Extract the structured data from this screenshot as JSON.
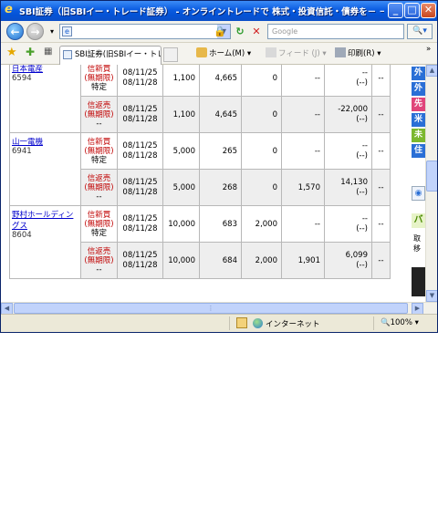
{
  "window": {
    "title": "SBI証券（旧SBIイー・トレード証券） - オンライントレードで 株式・投資信託・債券を－ － Win...",
    "minimize": "_",
    "maximize": "□",
    "close": "✕"
  },
  "address_bar": {
    "back": "←",
    "forward": "→",
    "url": "",
    "search_placeholder": "Google",
    "search_button": "🔍▾"
  },
  "tabs": [
    {
      "label": "SBI証券(旧SBIイー・トレー..."
    }
  ],
  "commands": {
    "home": "ホーム(M)",
    "feeds": "フィード (J)",
    "print": "印刷(R)"
  },
  "table": {
    "stocks": [
      {
        "name": "日本電産",
        "code": "6594",
        "rows": [
          {
            "kind": [
              "信新買",
              "(無期限)",
              "特定"
            ],
            "dates": [
              "08/11/25",
              "08/11/28"
            ],
            "qty": "1,100",
            "price": "4,665",
            "c3": "0",
            "c4": "--",
            "c5": [
              "--",
              "(--)"
            ],
            "c6": "--"
          },
          {
            "kind": [
              "信返売",
              "(無期限)",
              "--"
            ],
            "dates": [
              "08/11/25",
              "08/11/28"
            ],
            "qty": "1,100",
            "price": "4,645",
            "c3": "0",
            "c4": "--",
            "c5": [
              "-22,000",
              "(--)"
            ],
            "c6": "--"
          }
        ]
      },
      {
        "name": "山一電機",
        "code": "6941",
        "rows": [
          {
            "kind": [
              "信新買",
              "(無期限)",
              "特定"
            ],
            "dates": [
              "08/11/25",
              "08/11/28"
            ],
            "qty": "5,000",
            "price": "265",
            "c3": "0",
            "c4": "--",
            "c5": [
              "--",
              "(--)"
            ],
            "c6": "--"
          },
          {
            "kind": [
              "信返売",
              "(無期限)",
              "--"
            ],
            "dates": [
              "08/11/25",
              "08/11/28"
            ],
            "qty": "5,000",
            "price": "268",
            "c3": "0",
            "c4": "1,570",
            "c5": [
              "14,130",
              "(--)"
            ],
            "c6": "--"
          }
        ]
      },
      {
        "name": "野村ホールディングス",
        "code": "8604",
        "rows": [
          {
            "kind": [
              "信新買",
              "(無期限)",
              "特定"
            ],
            "dates": [
              "08/11/25",
              "08/11/28"
            ],
            "qty": "10,000",
            "price": "683",
            "c3": "2,000",
            "c4": "--",
            "c5": [
              "--",
              "(--)"
            ],
            "c6": "--"
          },
          {
            "kind": [
              "信返売",
              "(無期限)",
              "--"
            ],
            "dates": [
              "08/11/25",
              "08/11/28"
            ],
            "qty": "10,000",
            "price": "684",
            "c3": "2,000",
            "c4": "1,901",
            "c5": [
              "6,099",
              "(--)"
            ],
            "c6": "--"
          }
        ]
      }
    ]
  },
  "side_panel": {
    "buttons": [
      {
        "label": "外",
        "color": "#2a6fd6"
      },
      {
        "label": "外",
        "color": "#2a6fd6"
      },
      {
        "label": "先",
        "color": "#e0457a"
      },
      {
        "label": "米",
        "color": "#2a6fd6"
      },
      {
        "label": "未",
        "color": "#7cb82e"
      },
      {
        "label": "住",
        "color": "#2a6fd6"
      }
    ],
    "banner_text": "バ",
    "note_lines": [
      "取",
      "移"
    ]
  },
  "status_bar": {
    "zone": "インターネット",
    "zoom": "100%"
  }
}
